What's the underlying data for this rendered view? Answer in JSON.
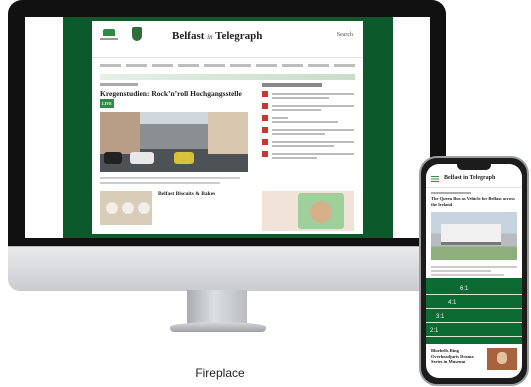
{
  "caption": "Fireplace",
  "site": {
    "brand_main": "Belfast",
    "brand_mid": "in",
    "brand_end": "Telegraph",
    "search_label": "Search",
    "headline": "Kregenstudien: Rock’n’roll Hochgangsstelle",
    "headline_badge": "LIVE",
    "sub_headline": "Belfast Biscuits & Bakes"
  },
  "phone": {
    "brand": "Belfast in Telegraph",
    "title": "The Queen Bus as Vehicle for Belfast across the Ireland",
    "bottom_title": "Bluebells Ring Overheadjuris Drama Series in Museum",
    "scores": [
      "6:1",
      "4:1",
      "3:1",
      "2:1"
    ]
  },
  "colors": {
    "brand_green": "#0c5a2c",
    "accent_red": "#c33333"
  }
}
